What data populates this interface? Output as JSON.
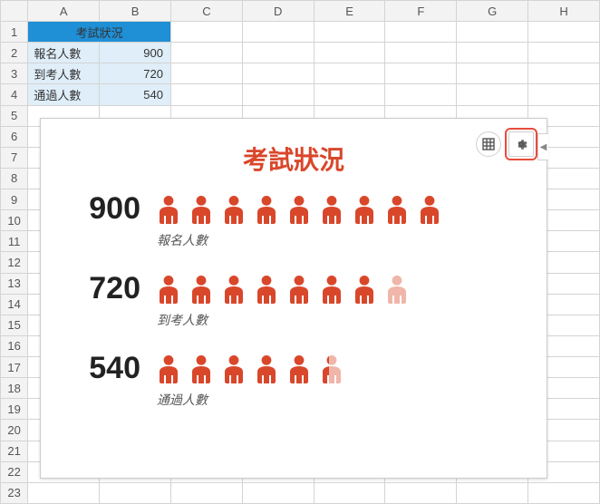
{
  "columns": [
    "A",
    "B",
    "C",
    "D",
    "E",
    "F",
    "G",
    "H"
  ],
  "row_count": 23,
  "table": {
    "header": "考試狀況",
    "rows": [
      {
        "label": "報名人數",
        "value": "900"
      },
      {
        "label": "到考人數",
        "value": "720"
      },
      {
        "label": "通過人數",
        "value": "540"
      }
    ]
  },
  "chart": {
    "title": "考試狀況",
    "icon_total": 9,
    "rows": [
      {
        "value": "900",
        "label": "報名人數",
        "full": 9,
        "partial": 0
      },
      {
        "value": "720",
        "label": "到考人數",
        "full": 7,
        "partial": 0.2
      },
      {
        "value": "540",
        "label": "通過人數",
        "full": 5,
        "partial": 0.4
      }
    ]
  },
  "toolbar": {
    "table_btn": "table-icon",
    "settings_btn": "gear-icon"
  },
  "chart_data": {
    "type": "bar",
    "categories": [
      "報名人數",
      "到考人數",
      "通過人數"
    ],
    "values": [
      900,
      720,
      540
    ],
    "title": "考試狀況",
    "xlabel": "",
    "ylabel": "",
    "ylim": [
      0,
      900
    ]
  }
}
